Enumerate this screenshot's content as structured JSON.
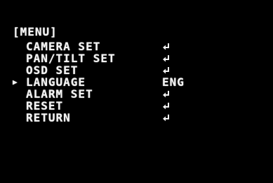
{
  "menu": {
    "title": "[MENU]",
    "items": [
      {
        "label": "CAMERA SET",
        "selected": false,
        "cursor": "",
        "value": "",
        "icon": "enter-icon"
      },
      {
        "label": "PAN/TILT SET",
        "selected": false,
        "cursor": "",
        "value": "",
        "icon": "enter-icon"
      },
      {
        "label": "OSD SET",
        "selected": false,
        "cursor": "",
        "value": "",
        "icon": "enter-icon"
      },
      {
        "label": "LANGUAGE",
        "selected": true,
        "cursor": "▶",
        "value": "ENG",
        "icon": ""
      },
      {
        "label": "ALARM SET",
        "selected": false,
        "cursor": "",
        "value": "",
        "icon": "enter-icon"
      },
      {
        "label": "RESET",
        "selected": false,
        "cursor": "",
        "value": "",
        "icon": "enter-icon"
      },
      {
        "label": "RETURN",
        "selected": false,
        "cursor": "",
        "value": "",
        "icon": "enter-icon"
      }
    ]
  },
  "colors": {
    "background": "#000000",
    "text": "#f2f2f2"
  }
}
